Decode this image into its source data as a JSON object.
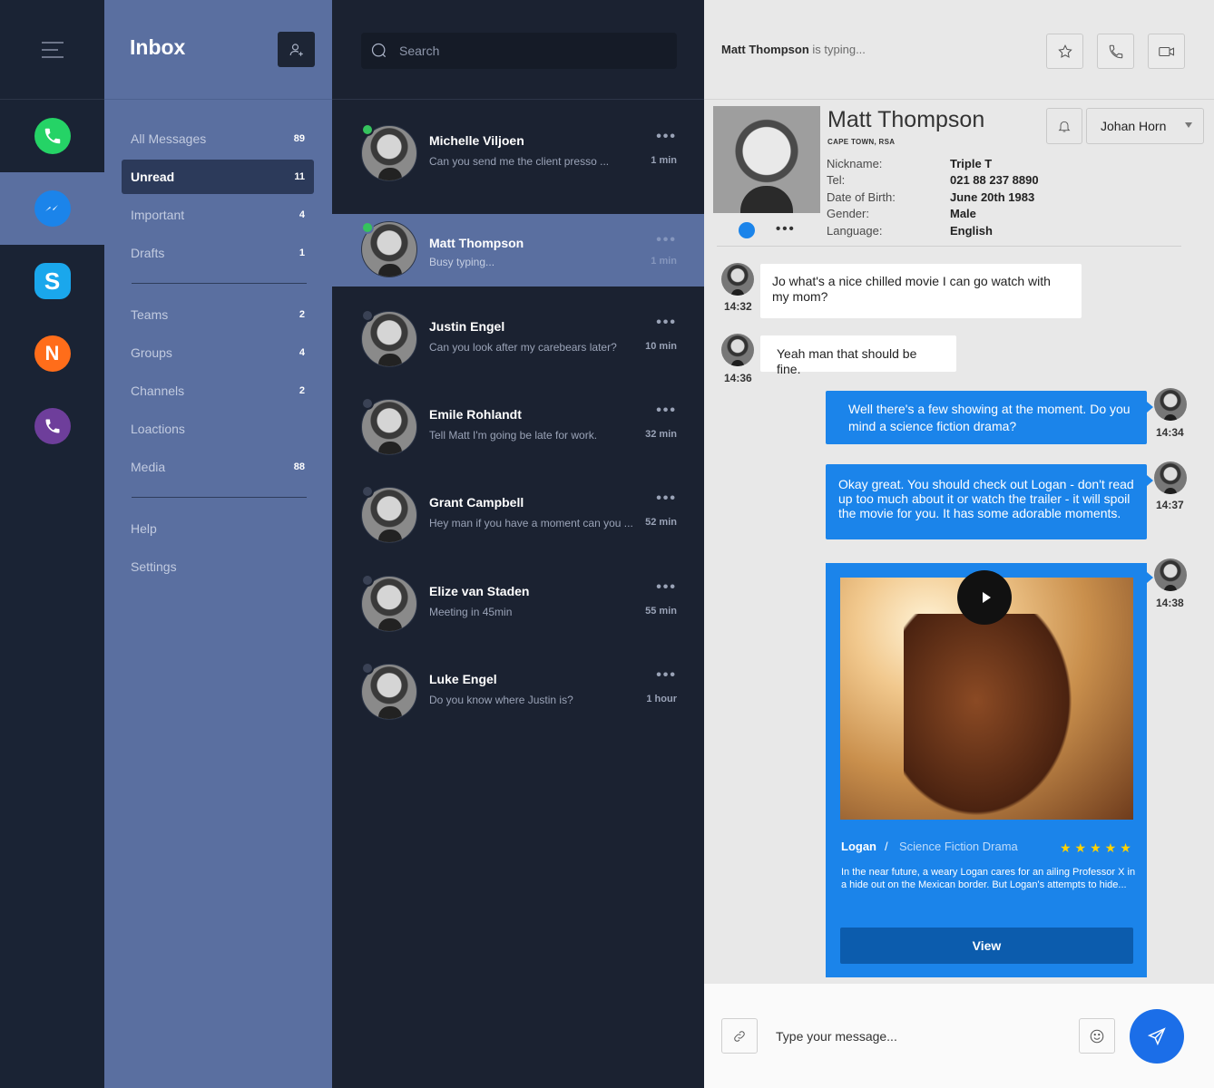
{
  "apps": [
    {
      "name": "whatsapp",
      "color": "#25d366",
      "active": false
    },
    {
      "name": "messenger",
      "color": "#1b84ea",
      "active": true
    },
    {
      "name": "skype",
      "color": "#1aa7ec",
      "active": false
    },
    {
      "name": "n-app",
      "color": "#ff6d1a",
      "active": false
    },
    {
      "name": "viber",
      "color": "#6e3e9b",
      "active": false
    }
  ],
  "folders": {
    "title": "Inbox",
    "items": [
      {
        "label": "All Messages",
        "count": "89"
      },
      {
        "label": "Unread",
        "count": "11"
      },
      {
        "label": "Important",
        "count": "4"
      },
      {
        "label": "Drafts",
        "count": "1"
      },
      {
        "label": "Teams",
        "count": "2"
      },
      {
        "label": "Groups",
        "count": "4"
      },
      {
        "label": "Channels",
        "count": "2"
      },
      {
        "label": "Loactions",
        "count": ""
      },
      {
        "label": "Media",
        "count": "88"
      },
      {
        "label": "Help",
        "count": ""
      },
      {
        "label": "Settings",
        "count": ""
      }
    ]
  },
  "search": {
    "placeholder": "Search"
  },
  "conversations": [
    {
      "name": "Michelle Viljoen",
      "message": "Can you send me the client presso ...",
      "time": "1 min",
      "online": true
    },
    {
      "name": "Matt Thompson",
      "message": "Busy typing...",
      "time": "1 min",
      "online": true
    },
    {
      "name": "Justin Engel",
      "message": "Can you look after my carebears later?",
      "time": "10 min",
      "online": false
    },
    {
      "name": "Emile Rohlandt",
      "message": "Tell Matt I'm going be late for work.",
      "time": "32 min",
      "online": false
    },
    {
      "name": "Grant Campbell",
      "message": "Hey man if you have a moment can you ...",
      "time": "52 min",
      "online": false
    },
    {
      "name": "Elize van Staden",
      "message": "Meeting in 45min",
      "time": "55 min",
      "online": false
    },
    {
      "name": "Luke Engel",
      "message": "Do you know where Justin is?",
      "time": "1 hour",
      "online": false
    }
  ],
  "chat": {
    "typing_name": "Matt Thompson",
    "typing_suffix": " is typing...",
    "assignee": "Johan Horn",
    "profile": {
      "name": "Matt Thompson",
      "location": "CAPE TOWN, RSA",
      "fields": [
        {
          "k": "Nickname:",
          "v": "Triple T"
        },
        {
          "k": "Tel:",
          "v": "021 88 237 8890"
        },
        {
          "k": "Date of Birth:",
          "v": "June 20th 1983"
        },
        {
          "k": "Gender:",
          "v": "Male"
        },
        {
          "k": "Language:",
          "v": "English"
        }
      ]
    },
    "messages": [
      {
        "text": "Jo what's a nice chilled movie I can go watch with my mom?",
        "time": "14:32"
      },
      {
        "text": "Yeah man that should be fine.",
        "time": "14:36"
      },
      {
        "text": "Well there's a few showing at the moment. Do you mind a science fiction drama?",
        "time": "14:34"
      },
      {
        "text": "Okay great. You should check out Logan - don't read up too much about it or watch the trailer - it will spoil the movie for you. It has some adorable moments.",
        "time": "14:37"
      }
    ],
    "movie_card": {
      "time": "14:38",
      "title": "Logan",
      "separator": "/",
      "genre": "Science Fiction Drama",
      "rating": 5,
      "description": "In the near future, a weary Logan cares for an ailing Professor X in a hide out on the Mexican border. But Logan's attempts to hide...",
      "button": "View"
    },
    "composer_placeholder": "Type your message..."
  }
}
